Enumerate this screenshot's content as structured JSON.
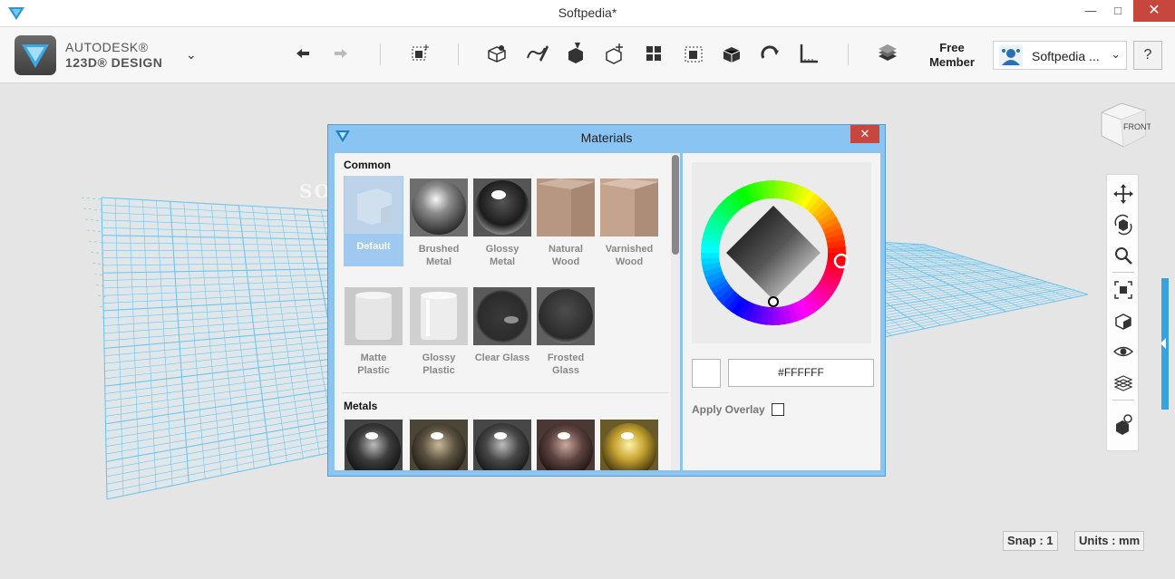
{
  "window": {
    "title": "Softpedia*",
    "minimize": "—",
    "maximize": "□",
    "close": "✕"
  },
  "brand": {
    "line1": "AUTODESK®",
    "line2": "123D® DESIGN",
    "menu_caret": "⌄"
  },
  "toolbar": {
    "items": [
      "undo-icon",
      "redo-icon",
      "primitives-icon",
      "sketch-icon",
      "construct-icon",
      "modify-icon",
      "transform-icon",
      "pattern-icon",
      "grouping-icon",
      "combine-icon",
      "snap-icon",
      "measure-icon",
      "material-icon"
    ],
    "free_member_line1": "Free",
    "free_member_line2": "Member",
    "user_name": "Softpedia ...",
    "user_caret": "⌄",
    "help": "?"
  },
  "materials": {
    "title": "Materials",
    "close": "✕",
    "sections": {
      "common": "Common",
      "metals": "Metals"
    },
    "common_items": [
      {
        "label": "Default"
      },
      {
        "label": "Brushed Metal"
      },
      {
        "label": "Glossy Metal"
      },
      {
        "label": "Natural Wood"
      },
      {
        "label": "Varnished Wood"
      },
      {
        "label": "Matte Plastic"
      },
      {
        "label": "Glossy Plastic"
      },
      {
        "label": "Clear Glass"
      },
      {
        "label": "Frosted Glass"
      }
    ],
    "selected": "Default",
    "color_hex": "#FFFFFF",
    "apply_overlay": "Apply Overlay"
  },
  "status": {
    "snap": "Snap : 1",
    "units": "Units : mm"
  },
  "viewcube": {
    "face": "FRONT"
  },
  "watermark": "SOFTPEDIA",
  "colors": {
    "dialog_title": "#8ac4f2",
    "accent": "#36a3e0",
    "grid": "#6fc4ec",
    "close": "#c7463d"
  }
}
